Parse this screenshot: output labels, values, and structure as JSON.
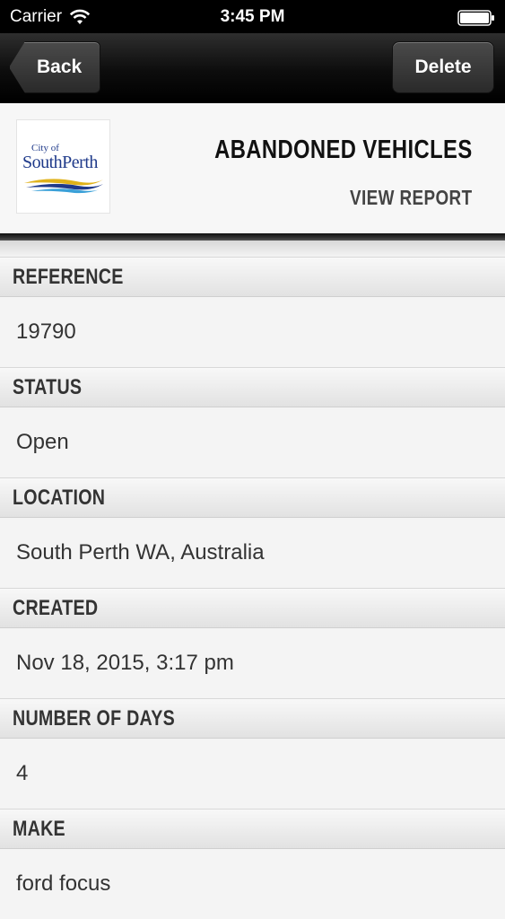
{
  "status_bar": {
    "carrier": "Carrier",
    "time": "3:45 PM"
  },
  "nav": {
    "back_label": "Back",
    "delete_label": "Delete"
  },
  "header": {
    "logo_city": "City of",
    "logo_name": "SouthPerth",
    "title": "ABANDONED VEHICLES",
    "view_report": "VIEW REPORT"
  },
  "fields": [
    {
      "label": "REFERENCE",
      "value": "19790"
    },
    {
      "label": "STATUS",
      "value": "Open"
    },
    {
      "label": "LOCATION",
      "value": "South Perth WA, Australia"
    },
    {
      "label": "CREATED",
      "value": "Nov 18, 2015, 3:17 pm"
    },
    {
      "label": "NUMBER OF DAYS",
      "value": "4"
    },
    {
      "label": "MAKE",
      "value": "ford focus"
    }
  ],
  "colors": {
    "logo_blue": "#1f3a8a",
    "logo_gold": "#e0b21a",
    "logo_light_blue": "#3aa0d8"
  }
}
